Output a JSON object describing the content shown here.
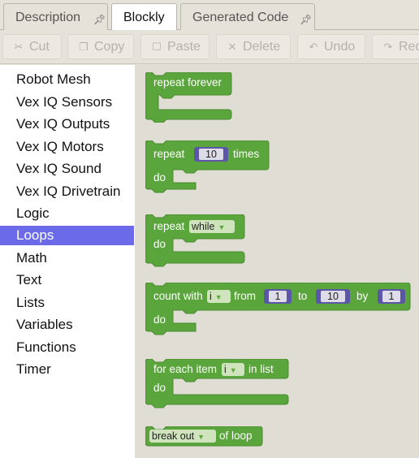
{
  "tabs": [
    {
      "label": "Description",
      "active": false,
      "pinned": true
    },
    {
      "label": "Blockly",
      "active": true,
      "pinned": false
    },
    {
      "label": "Generated Code",
      "active": false,
      "pinned": true
    }
  ],
  "toolbar": {
    "cut": "Cut",
    "copy": "Copy",
    "paste": "Paste",
    "delete": "Delete",
    "undo": "Undo",
    "redo": "Redo"
  },
  "categories": [
    "Robot Mesh",
    "Vex IQ Sensors",
    "Vex IQ Outputs",
    "Vex IQ Motors",
    "Vex IQ Sound",
    "Vex IQ Drivetrain",
    "Logic",
    "Loops",
    "Math",
    "Text",
    "Lists",
    "Variables",
    "Functions",
    "Timer"
  ],
  "selected_category": "Loops",
  "blocks": {
    "repeat_forever": {
      "label": "repeat forever"
    },
    "repeat_times": {
      "repeat": "repeat",
      "count": "10",
      "times": "times",
      "do": "do"
    },
    "repeat_while": {
      "repeat": "repeat",
      "mode": "while",
      "do": "do"
    },
    "count_with": {
      "label": "count with",
      "var": "i",
      "from": "from",
      "from_val": "1",
      "to": "to",
      "to_val": "10",
      "by": "by",
      "by_val": "1",
      "do": "do"
    },
    "for_each": {
      "label": "for each item",
      "var": "i",
      "in_list": "in list",
      "do": "do"
    },
    "break_out": {
      "mode": "break out",
      "of_loop": "of loop"
    }
  },
  "colors": {
    "block_green": "#5ba53d",
    "selection": "#6b6bea",
    "number_field": "#5b57a6"
  }
}
